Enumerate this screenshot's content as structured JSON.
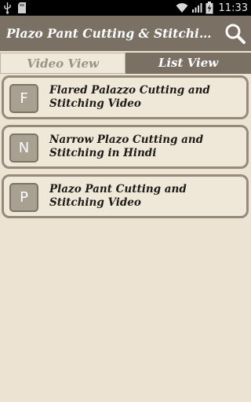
{
  "status_bar": {
    "time": "11:33",
    "icons": [
      "usb-icon",
      "sd-card-icon",
      "wifi-icon",
      "signal-icon",
      "battery-charging-icon"
    ]
  },
  "app_bar": {
    "title": "Plazo Pant Cutting & Stitching - Plazo Pant Cutting & Stitching",
    "search_icon": "search-icon",
    "colors": {
      "bar": "#7a7164",
      "background": "#ece3d3"
    }
  },
  "tabs": [
    {
      "label": "Video View",
      "selected": false
    },
    {
      "label": "List View",
      "selected": true
    }
  ],
  "items": [
    {
      "letter": "F",
      "title": "Flared Palazzo Cutting and Stitching Video"
    },
    {
      "letter": "N",
      "title": "Narrow Plazo Cutting and Stitching in Hindi"
    },
    {
      "letter": "P",
      "title": "Plazo Pant Cutting and Stitching Video"
    }
  ]
}
